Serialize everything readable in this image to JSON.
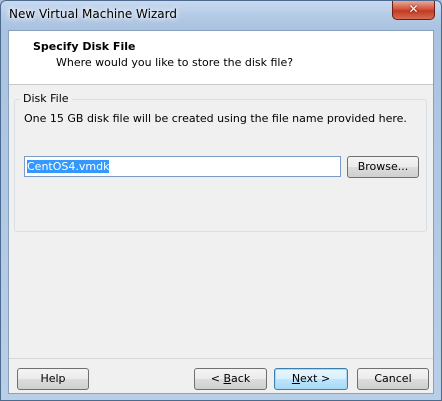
{
  "window": {
    "title": "New Virtual Machine Wizard",
    "close_glyph": "✕"
  },
  "header": {
    "title": "Specify Disk File",
    "subtitle": "Where would you like to store the disk file?"
  },
  "disk_file": {
    "legend": "Disk File",
    "description": "One 15 GB disk file will be created using the file name provided here.",
    "filename_value": "CentOS4.vmdk",
    "browse_label": "Browse..."
  },
  "footer": {
    "help_label": "Help",
    "back_prefix": "< ",
    "back_accel": "B",
    "back_rest": "ack",
    "next_accel": "N",
    "next_rest": "ext >",
    "cancel_label": "Cancel"
  },
  "colors": {
    "selection": "#3399ff",
    "default_button_border": "#3c7fb1",
    "close_button": "#c13a22"
  }
}
